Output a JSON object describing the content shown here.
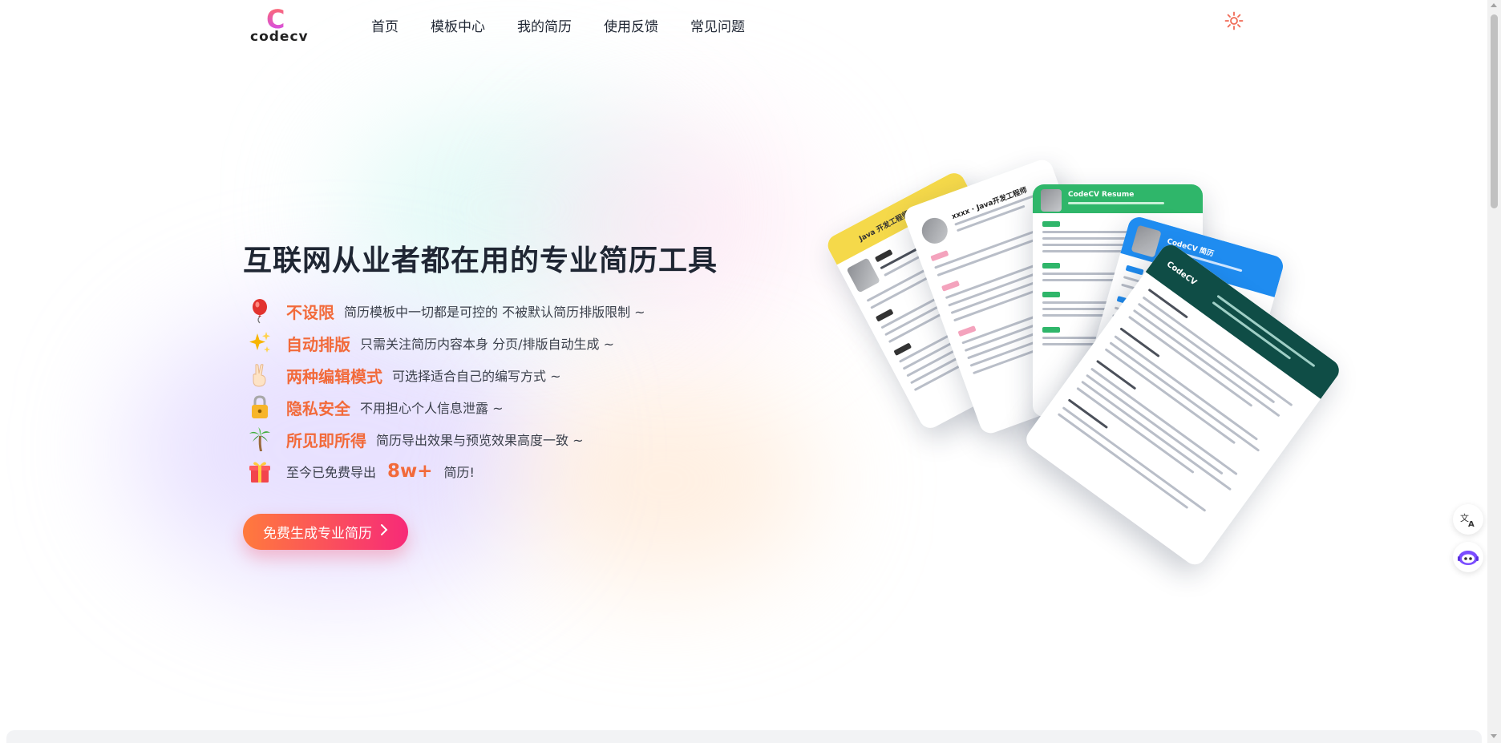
{
  "brand": {
    "logo_letter": "C",
    "logo_text": "codecv"
  },
  "nav": {
    "items": [
      {
        "label": "首页"
      },
      {
        "label": "模板中心"
      },
      {
        "label": "我的简历"
      },
      {
        "label": "使用反馈"
      },
      {
        "label": "常见问题"
      }
    ]
  },
  "theme_toggle": {
    "icon": "sun-icon"
  },
  "hero": {
    "title": "互联网从业者都在用的专业简历工具",
    "features": [
      {
        "icon": "balloon-icon",
        "title": "不设限",
        "desc": "简历模板中一切都是可控的 不被默认简历排版限制 ~"
      },
      {
        "icon": "sparkles-icon",
        "title": "自动排版",
        "desc": "只需关注简历内容本身 分页/排版自动生成 ~"
      },
      {
        "icon": "victory-hand-icon",
        "title": "两种编辑模式",
        "desc": "可选择适合自己的编写方式 ~"
      },
      {
        "icon": "lock-icon",
        "title": "隐私安全",
        "desc": "不用担心个人信息泄露 ~"
      },
      {
        "icon": "palm-tree-icon",
        "title": "所见即所得",
        "desc": "简历导出效果与预览效果高度一致 ~"
      }
    ],
    "export_stat": {
      "icon": "gift-icon",
      "prefix": "至今已免费导出",
      "count": "8w+",
      "suffix": "简历!"
    },
    "cta_label": "免费生成专业简历"
  },
  "cards": [
    {
      "title": "Java 开发工程师",
      "accent": "#f5d94a"
    },
    {
      "title": "xxxx · Java开发工程师",
      "accent": "#ffffff"
    },
    {
      "title": "CodeCV Resume",
      "accent": "#2fb66a"
    },
    {
      "title": "CodeCV 简历",
      "accent": "#1f8cf0"
    },
    {
      "title": "CodeCV",
      "accent": "#0f4d46"
    }
  ],
  "side_tools": [
    {
      "icon": "translate-icon"
    },
    {
      "icon": "robot-assistant-icon"
    }
  ],
  "colors": {
    "accent": "#f26a3a",
    "cta_start": "#ff7a3d",
    "cta_end": "#f72a78",
    "text": "#1f2633"
  }
}
